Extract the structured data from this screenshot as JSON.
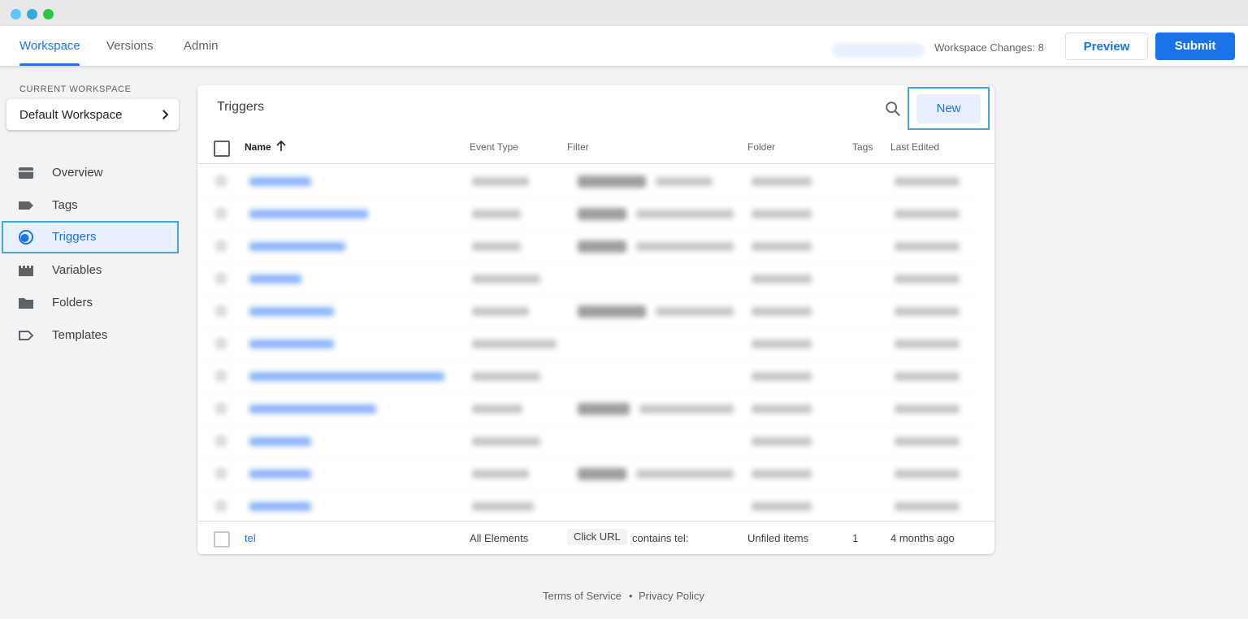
{
  "window": {
    "title": ""
  },
  "nav": {
    "tabs": [
      "Workspace",
      "Versions",
      "Admin"
    ],
    "active_tab": "Workspace",
    "workspace_changes": "Workspace Changes: 8",
    "preview_label": "Preview",
    "submit_label": "Submit"
  },
  "sidebar": {
    "current_workspace_label": "CURRENT WORKSPACE",
    "workspace_name": "Default Workspace",
    "items": [
      {
        "label": "Overview",
        "icon": "overview-icon"
      },
      {
        "label": "Tags",
        "icon": "tag-icon"
      },
      {
        "label": "Triggers",
        "icon": "trigger-icon",
        "active": true
      },
      {
        "label": "Variables",
        "icon": "variables-icon"
      },
      {
        "label": "Folders",
        "icon": "folder-icon"
      },
      {
        "label": "Templates",
        "icon": "template-icon"
      }
    ]
  },
  "triggers": {
    "title": "Triggers",
    "new_label": "New",
    "columns": {
      "name": "Name",
      "event_type": "Event Type",
      "filter": "Filter",
      "folder": "Folder",
      "tags": "Tags",
      "last_edited": "Last Edited"
    },
    "visible_row": {
      "name": "tel",
      "event_type": "All Elements",
      "filter_variable": "Click URL",
      "filter_condition": "contains tel:",
      "folder": "Unfiled items",
      "tags": "1",
      "last_edited": "4 months ago"
    }
  },
  "footer": {
    "terms": "Terms of Service",
    "separator": "•",
    "privacy": "Privacy Policy"
  },
  "colors": {
    "accent": "#1a73e8",
    "highlight_border": "#3fa9dd",
    "background": "#f1f3f4"
  }
}
